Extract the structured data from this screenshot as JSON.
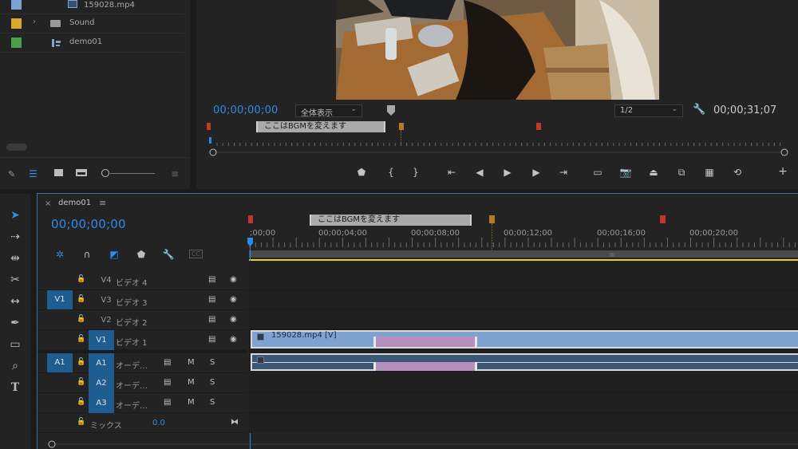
{
  "colors": {
    "accent": "#2d8ceb",
    "patch_blue": "#1f5c90",
    "label_blue": "#7ea3d2",
    "label_yellow": "#d6a930",
    "label_green": "#4aa04a",
    "marker_red": "#c0392b",
    "marker_orange": "#b47a2a",
    "video_clip": "#7ea3d2",
    "audio_clip": "#3a5875",
    "selected_range": "#b58fbd",
    "work_area_yellow": "#e1d51c"
  },
  "project": {
    "items": [
      {
        "label": "159028.mp4",
        "icon": "video-clip-icon",
        "color": "#7ea3d2"
      },
      {
        "label": "Sound",
        "icon": "folder-icon",
        "color": "#d6a930"
      },
      {
        "label": "demo01",
        "icon": "sequence-icon",
        "color": "#4aa04a"
      }
    ]
  },
  "program": {
    "timecode": "00;00;00;00",
    "fit_select": "全体表示",
    "resolution_select": "1/2",
    "duration": "00;00;31;07",
    "marker_comment": "ここはBGMを変えます"
  },
  "timeline": {
    "tab_title": "demo01",
    "timecode": "00;00;00;00",
    "marker_comment": "ここはBGMを変えます",
    "ruler_ticks": [
      ";00;00",
      "00;00;04;00",
      "00;00;08;00",
      "00;00;12;00",
      "00;00;16;00",
      "00;00;20;00"
    ],
    "source_patches": {
      "video": "V1",
      "audio": "A1"
    },
    "tracks": [
      {
        "id": "V4",
        "label": "ビデオ 4"
      },
      {
        "id": "V3",
        "label": "ビデオ 3"
      },
      {
        "id": "V2",
        "label": "ビデオ 2"
      },
      {
        "id": "V1",
        "label": "ビデオ 1"
      },
      {
        "id": "A1",
        "label": "オーデ…",
        "mute": "M",
        "solo": "S"
      },
      {
        "id": "A2",
        "label": "オーデ…",
        "mute": "M",
        "solo": "S"
      },
      {
        "id": "A3",
        "label": "オーデ…",
        "mute": "M",
        "solo": "S"
      }
    ],
    "mix": {
      "label": "ミックス",
      "value": "0.0"
    },
    "clip_label": "159028.mp4 [V]",
    "cc_label": "CC"
  }
}
